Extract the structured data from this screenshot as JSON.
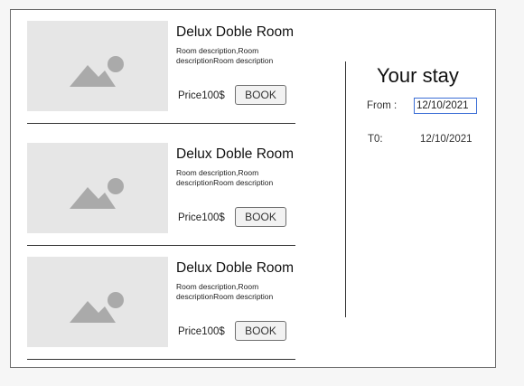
{
  "rooms": [
    {
      "name": "Delux Doble Room",
      "description": "Room description,Room descriptionRoom description",
      "price": "Price100$",
      "book_label": "BOOK",
      "image_icon": "image-placeholder-icon"
    },
    {
      "name": "Delux Doble Room",
      "description": "Room description,Room descriptionRoom description",
      "price": "Price100$",
      "book_label": "BOOK",
      "image_icon": "image-placeholder-icon"
    },
    {
      "name": "Delux Doble Room",
      "description": "Room description,Room descriptionRoom description",
      "price": "Price100$",
      "book_label": "BOOK",
      "image_icon": "image-placeholder-icon"
    }
  ],
  "stay": {
    "title": "Your stay",
    "from_label": "From :",
    "from_value": "12/10/2021",
    "to_label": "T0:",
    "to_value": "12/10/2021"
  },
  "colors": {
    "frame_border": "#6d6d6d",
    "thumb_bg": "#e6e6e6",
    "icon_fill": "#aaaaaa",
    "input_border": "#3b6ed6"
  }
}
